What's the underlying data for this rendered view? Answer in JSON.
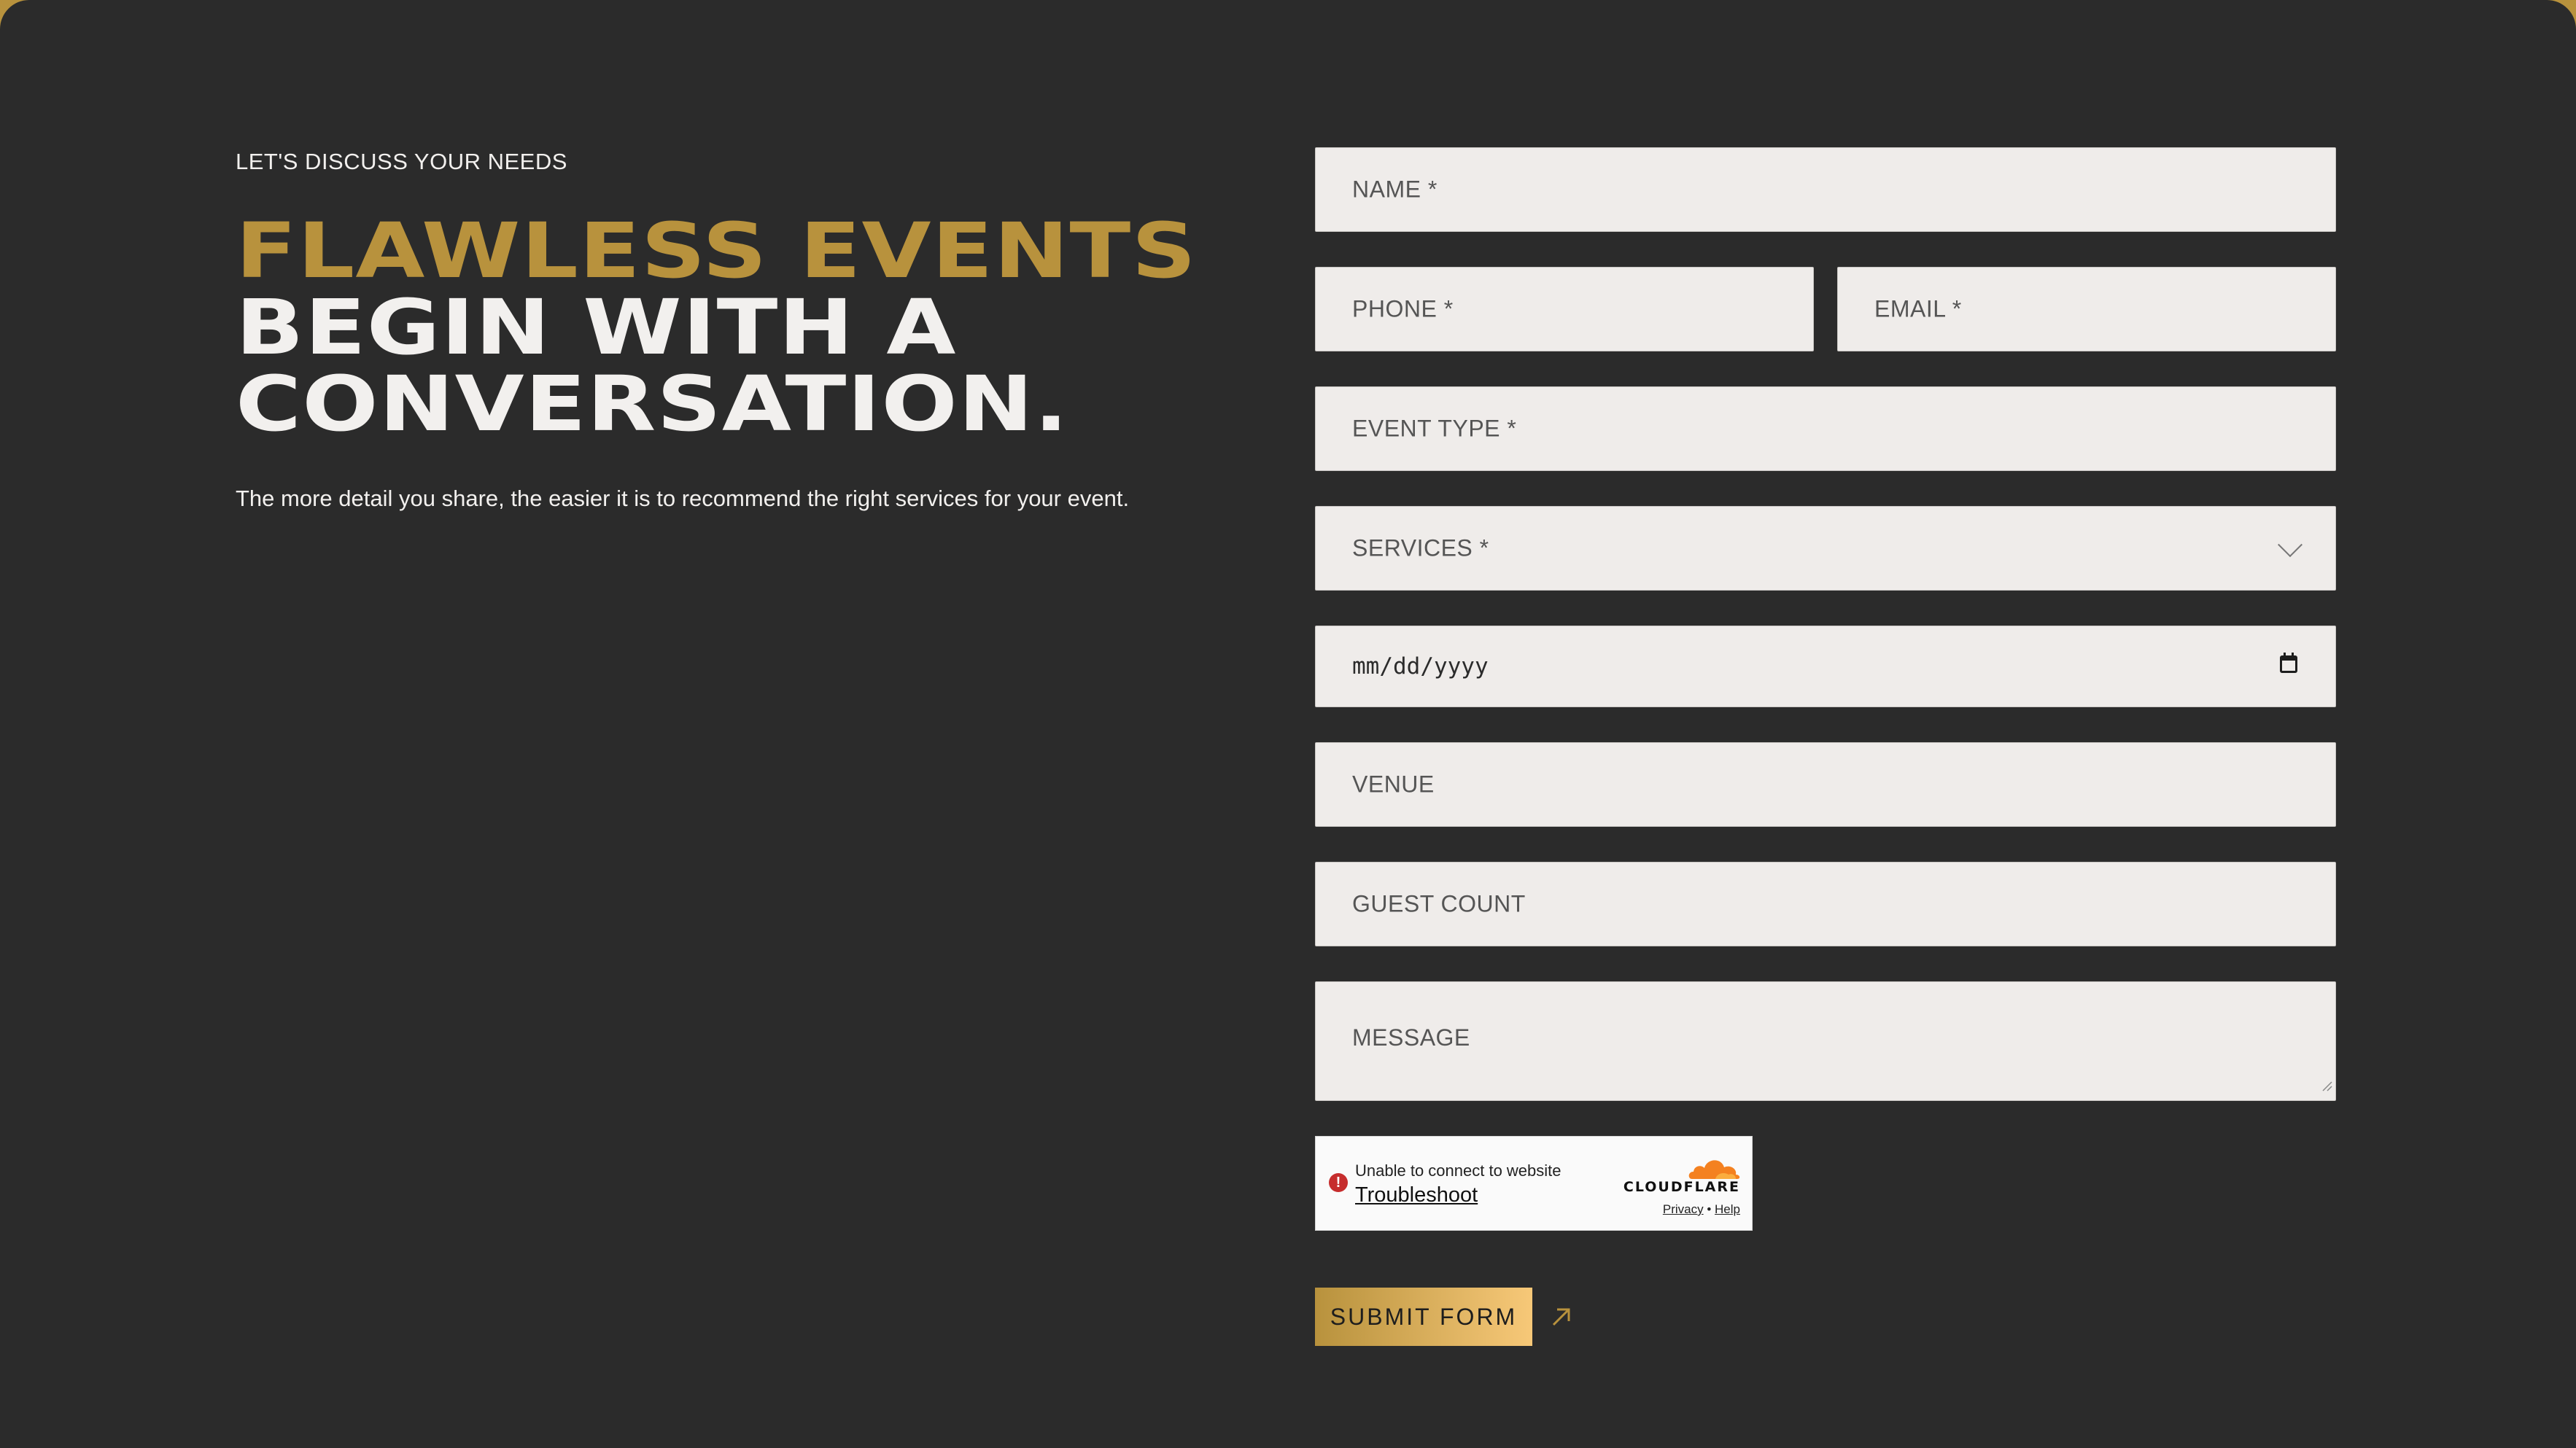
{
  "colors": {
    "background": "#2b2b2b",
    "gold": "#b8923d",
    "field_background": "#efecea",
    "text_light": "#f2f0ee"
  },
  "intro": {
    "eyebrow": "LET'S DISCUSS YOUR NEEDS",
    "headline_line1": "FLAWLESS EVENTS",
    "headline_line2": "BEGIN WITH A",
    "headline_line3": "CONVERSATION.",
    "lead": "The more detail you share, the easier it is to recommend the right services for your event."
  },
  "form": {
    "name_placeholder": "NAME *",
    "phone_placeholder": "PHONE *",
    "email_placeholder": "EMAIL *",
    "event_type_placeholder": "EVENT TYPE *",
    "services_placeholder": "SERVICES *",
    "date_placeholder": "mm/dd/yyyy",
    "venue_placeholder": "VENUE",
    "guest_count_placeholder": "GUEST COUNT",
    "message_placeholder": "MESSAGE",
    "submit_label": "SUBMIT FORM"
  },
  "captcha": {
    "message": "Unable to connect to website",
    "action": "Troubleshoot",
    "brand": "CLOUDFLARE",
    "privacy": "Privacy",
    "separator": "•",
    "help": "Help",
    "icons": [
      "error-icon",
      "cloudflare-cloud-icon"
    ]
  },
  "icons": [
    "chevron-down-icon",
    "calendar-icon",
    "resize-handle-icon",
    "arrow-up-right-icon"
  ]
}
